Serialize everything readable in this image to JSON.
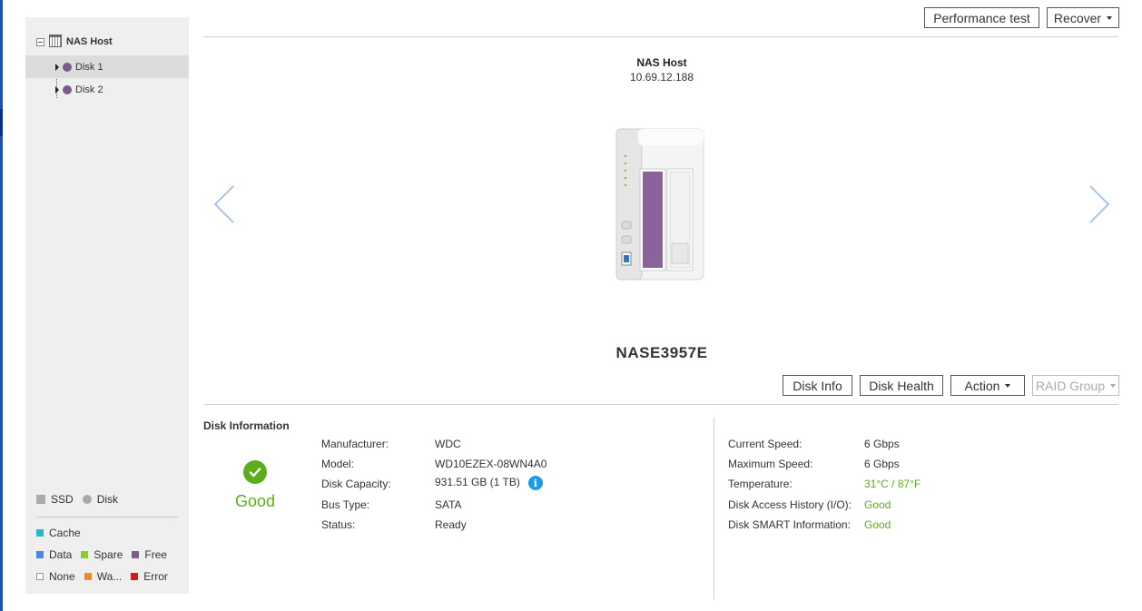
{
  "toolbar_top": {
    "performance_test": "Performance test",
    "recover": "Recover"
  },
  "tree": {
    "root": "NAS Host",
    "items": [
      {
        "label": "Disk 1",
        "color": "#7d5a8f"
      },
      {
        "label": "Disk 2",
        "color": "#7d5a8f"
      }
    ]
  },
  "legend": {
    "ssd": "SSD",
    "disk": "Disk",
    "cache": "Cache",
    "data": "Data",
    "spare": "Spare",
    "free": "Free",
    "none": "None",
    "warning": "Wa...",
    "error": "Error",
    "colors": {
      "cache": "#26b9c9",
      "data": "#4a86e8",
      "spare": "#8bcb2d",
      "free": "#7d5a8f",
      "warning": "#f08a24",
      "error": "#d0191b"
    }
  },
  "header": {
    "host_name": "NAS Host",
    "host_ip": "10.69.12.188"
  },
  "device_name": "NASE3957E",
  "actions": {
    "disk_info": "Disk Info",
    "disk_health": "Disk Health",
    "action": "Action",
    "raid_group": "RAID Group"
  },
  "disk_information": {
    "title": "Disk Information",
    "status": "Good",
    "left_fields": [
      {
        "label": "Manufacturer:",
        "value": "WDC"
      },
      {
        "label": "Model:",
        "value": "WD10EZEX-08WN4A0"
      },
      {
        "label": "Disk Capacity:",
        "value": "931.51 GB (1 TB)"
      },
      {
        "label": "Bus Type:",
        "value": "SATA"
      },
      {
        "label": "Status:",
        "value": "Ready"
      }
    ],
    "right_fields": [
      {
        "label": "Current Speed:",
        "value": "6 Gbps"
      },
      {
        "label": "Maximum Speed:",
        "value": "6 Gbps"
      },
      {
        "label": "Temperature:",
        "value": "31°C / 87°F"
      },
      {
        "label": "Disk Access History (I/O):",
        "value": "Good"
      },
      {
        "label": "Disk SMART Information:",
        "value": "Good"
      }
    ]
  },
  "accent_green": "#5cad1c",
  "accent_blue": "#1e9be8"
}
